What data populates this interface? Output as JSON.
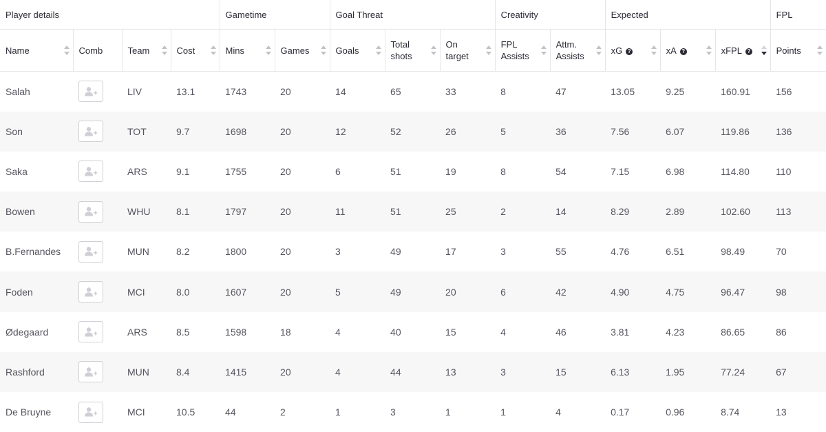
{
  "groups": [
    {
      "label": "Player details"
    },
    {
      "label": "Gametime"
    },
    {
      "label": "Goal Threat"
    },
    {
      "label": "Creativity"
    },
    {
      "label": "Expected"
    },
    {
      "label": "FPL"
    }
  ],
  "columns": [
    {
      "label": "Name"
    },
    {
      "label": "Comb"
    },
    {
      "label": "Team"
    },
    {
      "label": "Cost"
    },
    {
      "label": "Mins"
    },
    {
      "label": "Games"
    },
    {
      "label": "Goals"
    },
    {
      "label": "Total shots"
    },
    {
      "label": "On target"
    },
    {
      "label": "FPL Assists"
    },
    {
      "label": "Attm. Assists"
    },
    {
      "label": "xG"
    },
    {
      "label": "xA"
    },
    {
      "label": "xFPL"
    },
    {
      "label": "Points"
    }
  ],
  "sort": {
    "column": "xFPL",
    "direction": "descending"
  },
  "icons": {
    "sort": "sort-arrows-icon",
    "help": "help-circle-icon",
    "comb": "add-user-icon"
  },
  "colors": {
    "text": "#3c3c46",
    "header": "#2a2a35",
    "stripe": "#f7f7f7",
    "border": "#e6e6ea"
  },
  "rows": [
    {
      "name": "Salah",
      "team": "LIV",
      "cost": "13.1",
      "mins": "1743",
      "games": "20",
      "goals": "14",
      "shots": "65",
      "on_target": "33",
      "fpl_assists": "8",
      "attm_assists": "47",
      "xg": "13.05",
      "xa": "9.25",
      "xfpl": "160.91",
      "points": "156"
    },
    {
      "name": "Son",
      "team": "TOT",
      "cost": "9.7",
      "mins": "1698",
      "games": "20",
      "goals": "12",
      "shots": "52",
      "on_target": "26",
      "fpl_assists": "5",
      "attm_assists": "36",
      "xg": "7.56",
      "xa": "6.07",
      "xfpl": "119.86",
      "points": "136"
    },
    {
      "name": "Saka",
      "team": "ARS",
      "cost": "9.1",
      "mins": "1755",
      "games": "20",
      "goals": "6",
      "shots": "51",
      "on_target": "19",
      "fpl_assists": "8",
      "attm_assists": "54",
      "xg": "7.15",
      "xa": "6.98",
      "xfpl": "114.80",
      "points": "110"
    },
    {
      "name": "Bowen",
      "team": "WHU",
      "cost": "8.1",
      "mins": "1797",
      "games": "20",
      "goals": "11",
      "shots": "51",
      "on_target": "25",
      "fpl_assists": "2",
      "attm_assists": "14",
      "xg": "8.29",
      "xa": "2.89",
      "xfpl": "102.60",
      "points": "113"
    },
    {
      "name": "B.Fernandes",
      "team": "MUN",
      "cost": "8.2",
      "mins": "1800",
      "games": "20",
      "goals": "3",
      "shots": "49",
      "on_target": "17",
      "fpl_assists": "3",
      "attm_assists": "55",
      "xg": "4.76",
      "xa": "6.51",
      "xfpl": "98.49",
      "points": "70"
    },
    {
      "name": "Foden",
      "team": "MCI",
      "cost": "8.0",
      "mins": "1607",
      "games": "20",
      "goals": "5",
      "shots": "49",
      "on_target": "20",
      "fpl_assists": "6",
      "attm_assists": "42",
      "xg": "4.90",
      "xa": "4.75",
      "xfpl": "96.47",
      "points": "98"
    },
    {
      "name": "Ødegaard",
      "team": "ARS",
      "cost": "8.5",
      "mins": "1598",
      "games": "18",
      "goals": "4",
      "shots": "40",
      "on_target": "15",
      "fpl_assists": "4",
      "attm_assists": "46",
      "xg": "3.81",
      "xa": "4.23",
      "xfpl": "86.65",
      "points": "86"
    },
    {
      "name": "Rashford",
      "team": "MUN",
      "cost": "8.4",
      "mins": "1415",
      "games": "20",
      "goals": "4",
      "shots": "44",
      "on_target": "13",
      "fpl_assists": "3",
      "attm_assists": "15",
      "xg": "6.13",
      "xa": "1.95",
      "xfpl": "77.24",
      "points": "67"
    },
    {
      "name": "De Bruyne",
      "team": "MCI",
      "cost": "10.5",
      "mins": "44",
      "games": "2",
      "goals": "1",
      "shots": "3",
      "on_target": "1",
      "fpl_assists": "1",
      "attm_assists": "4",
      "xg": "0.17",
      "xa": "0.96",
      "xfpl": "8.74",
      "points": "13"
    }
  ]
}
